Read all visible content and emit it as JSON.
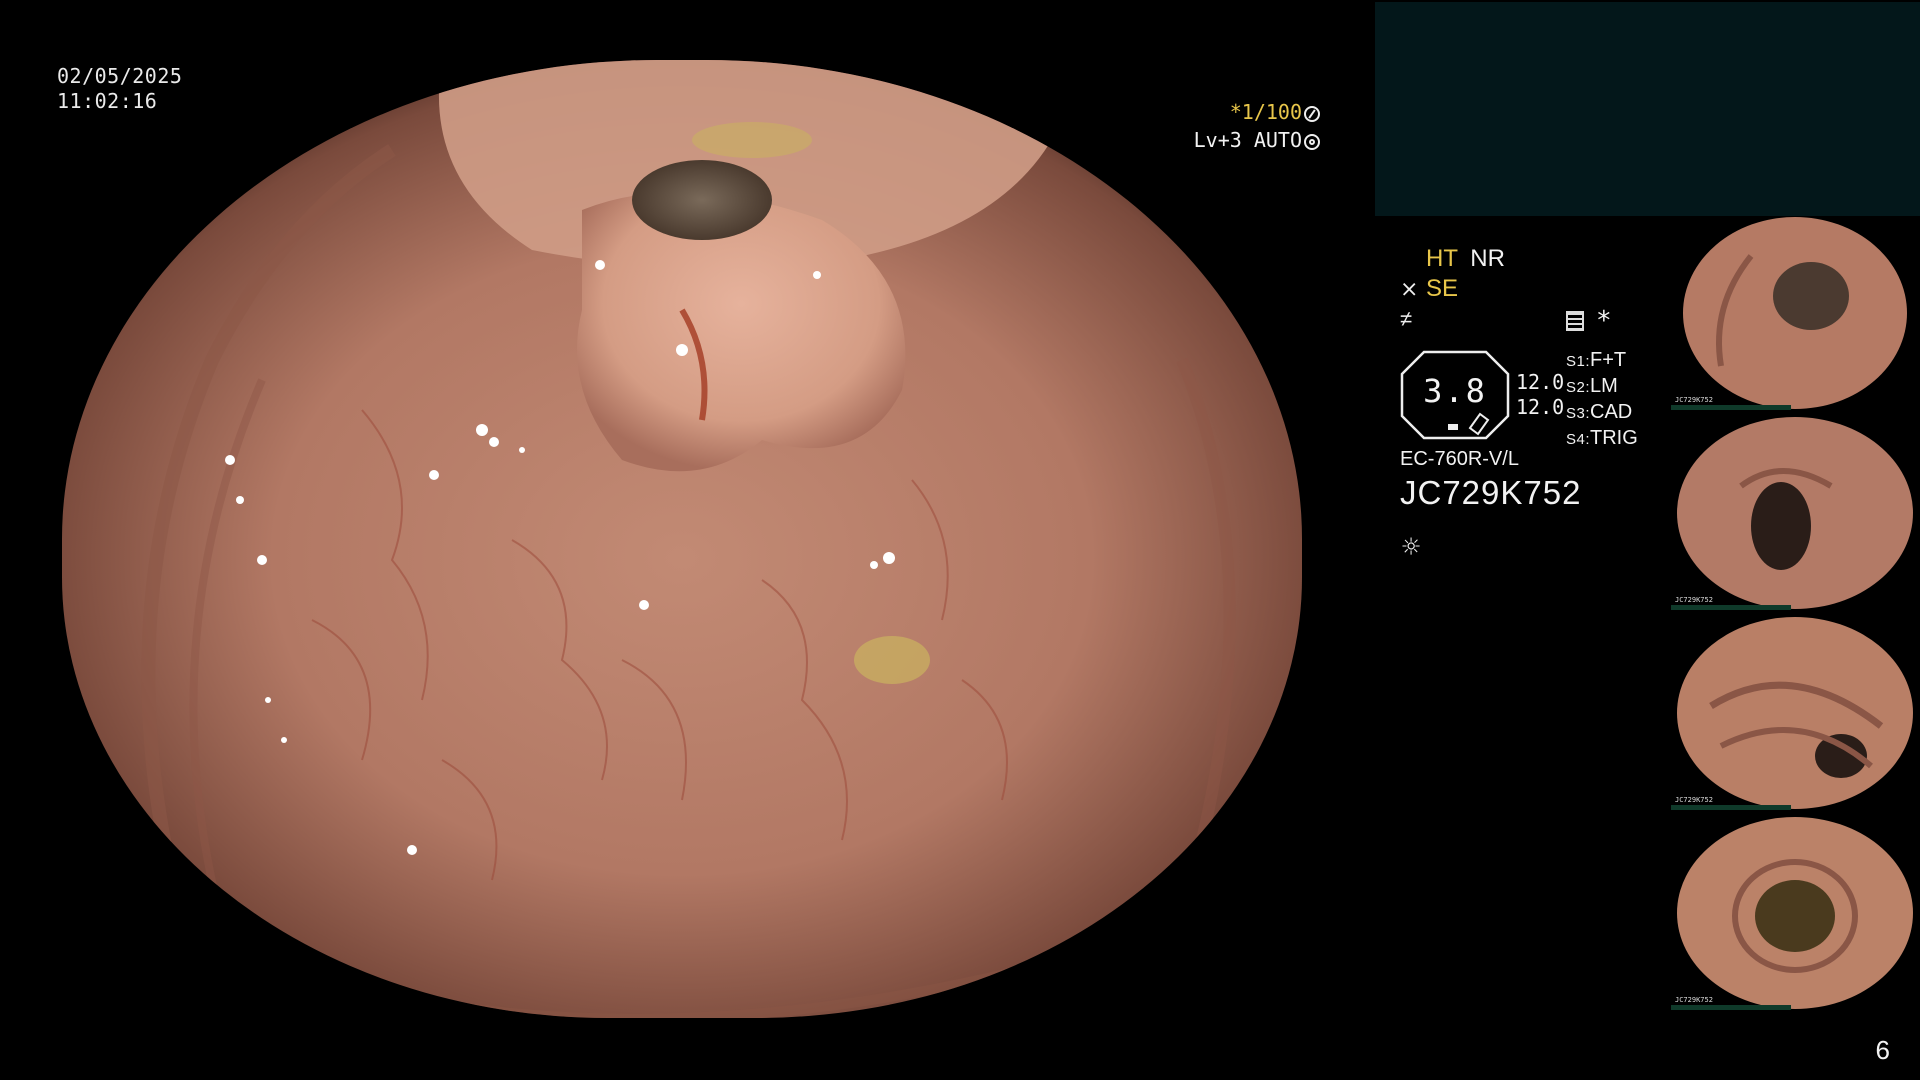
{
  "datetime": {
    "date": "02/05/2025",
    "time": "11:02:16"
  },
  "view_status": {
    "zoom": "*1/100",
    "level": "Lv+3 AUTO"
  },
  "settings": {
    "ht": "HT",
    "nr": "NR",
    "se": "SE",
    "icons": [
      "pen-icon",
      "scribble-icon"
    ]
  },
  "scope": {
    "value": "3.8",
    "num1": "12.0",
    "num2": "12.0",
    "model": "EC-760R-V/L",
    "serial": "JC729K752"
  },
  "record": {
    "star": "*"
  },
  "switches": [
    {
      "key": "S1:",
      "value": "F+T"
    },
    {
      "key": "S2:",
      "value": "LM"
    },
    {
      "key": "S3:",
      "value": "CAD"
    },
    {
      "key": "S4:",
      "value": "TRIG"
    }
  ],
  "thumbnails": [
    {
      "caption_serial": "JC729K752"
    },
    {
      "caption_serial": "JC729K752"
    },
    {
      "caption_serial": "JC729K752"
    },
    {
      "caption_serial": "JC729K752"
    }
  ],
  "page": "6",
  "colors": {
    "accent_yellow": "#e8c64a",
    "panel_dark": "#03171a",
    "tissue": "#b87c66"
  }
}
